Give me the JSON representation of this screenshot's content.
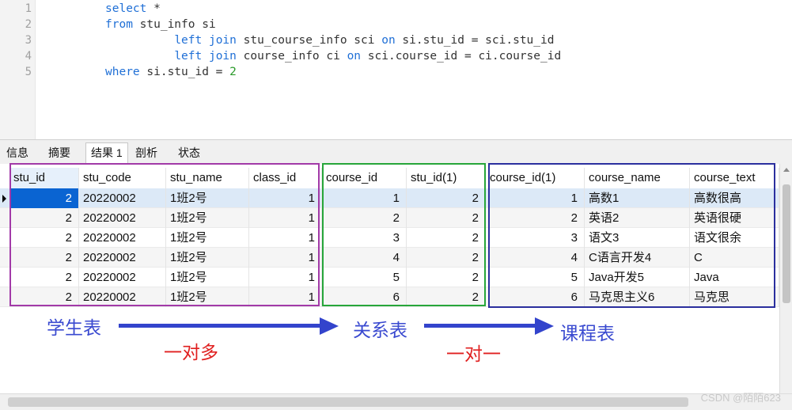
{
  "editor": {
    "line_numbers": [
      "1",
      "2",
      "3",
      "4",
      "5"
    ],
    "lines": [
      {
        "indent": "",
        "tokens": [
          {
            "t": "select",
            "k": "kw"
          },
          {
            "t": " *",
            "k": ""
          }
        ]
      },
      {
        "indent": "",
        "tokens": [
          {
            "t": "from",
            "k": "kw"
          },
          {
            "t": " stu_info si",
            "k": ""
          }
        ]
      },
      {
        "indent": "          ",
        "tokens": [
          {
            "t": "left join",
            "k": "kw"
          },
          {
            "t": " stu_course_info sci ",
            "k": ""
          },
          {
            "t": "on",
            "k": "kw"
          },
          {
            "t": " si.stu_id = sci.stu_id",
            "k": ""
          }
        ]
      },
      {
        "indent": "          ",
        "tokens": [
          {
            "t": "left join",
            "k": "kw"
          },
          {
            "t": " course_info ci ",
            "k": ""
          },
          {
            "t": "on",
            "k": "kw"
          },
          {
            "t": " sci.course_id = ci.course_id",
            "k": ""
          }
        ]
      },
      {
        "indent": "",
        "tokens": [
          {
            "t": "where",
            "k": "kw"
          },
          {
            "t": " si.stu_id = ",
            "k": ""
          },
          {
            "t": "2",
            "k": "num"
          }
        ]
      }
    ]
  },
  "tabs": [
    "信息",
    "摘要",
    "结果 1",
    "剖析",
    "状态"
  ],
  "active_tab": 2,
  "grid": {
    "columns": [
      "stu_id",
      "stu_code",
      "stu_name",
      "class_id",
      "course_id",
      "stu_id(1)",
      "course_id(1)",
      "course_name",
      "course_text"
    ],
    "rows": [
      [
        "2",
        "20220002",
        "1班2号",
        "1",
        "1",
        "2",
        "1",
        "高数1",
        "高数很高"
      ],
      [
        "2",
        "20220002",
        "1班2号",
        "1",
        "2",
        "2",
        "2",
        "英语2",
        "英语很硬"
      ],
      [
        "2",
        "20220002",
        "1班2号",
        "1",
        "3",
        "2",
        "3",
        "语文3",
        "语文很余"
      ],
      [
        "2",
        "20220002",
        "1班2号",
        "1",
        "4",
        "2",
        "4",
        "C语言开发4",
        "C"
      ],
      [
        "2",
        "20220002",
        "1班2号",
        "1",
        "5",
        "2",
        "5",
        "Java开发5",
        "Java"
      ],
      [
        "2",
        "20220002",
        "1班2号",
        "1",
        "6",
        "2",
        "6",
        "马克思主义6",
        "马克思"
      ]
    ]
  },
  "annotations": {
    "student_table": "学生表",
    "relation_table": "关系表",
    "course_table": "课程表",
    "one_to_many": "一对多",
    "one_to_one": "一对一"
  },
  "colors": {
    "student_box": "#a23aa8",
    "relation_box": "#27a63a",
    "course_box": "#2b2f9e",
    "label_blue": "#3a4ad0",
    "label_red": "#e02020",
    "arrow": "#3344cc",
    "selected_cell": "#0a64d2"
  },
  "watermark": "CSDN @陌陌623"
}
